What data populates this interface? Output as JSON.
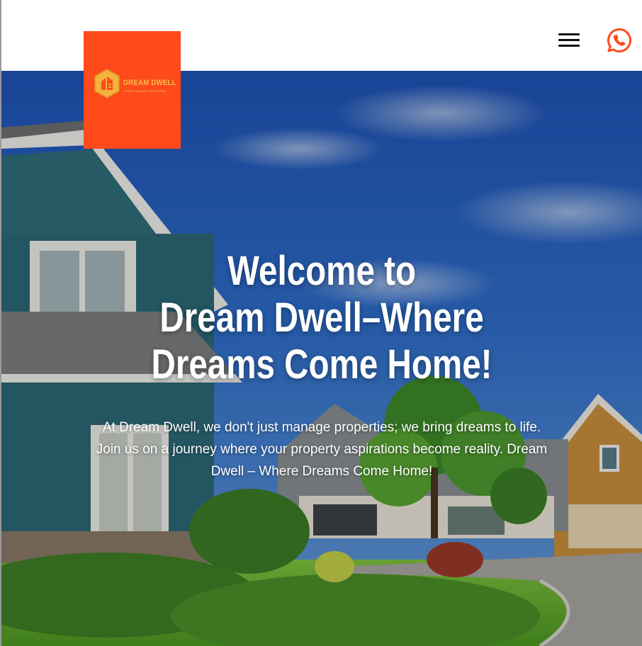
{
  "header": {
    "menu_icon": "hamburger-menu-icon",
    "whatsapp_icon": "whatsapp-icon",
    "accent_color": "#ff4a1c"
  },
  "logo": {
    "name": "DREAM DWELL",
    "tagline": "WHERE DREAMS COME HOME",
    "background": "#ff4a1c",
    "text_color": "#f5c04a"
  },
  "hero": {
    "title_lines": [
      "Welcome to",
      "Dream Dwell–Where",
      "Dreams Come Home!"
    ],
    "text": "At Dream Dwell, we don't just manage properties; we bring dreams to life. Join us on a journey where your property aspirations become reality. Dream Dwell – Where Dreams Come Home!"
  }
}
